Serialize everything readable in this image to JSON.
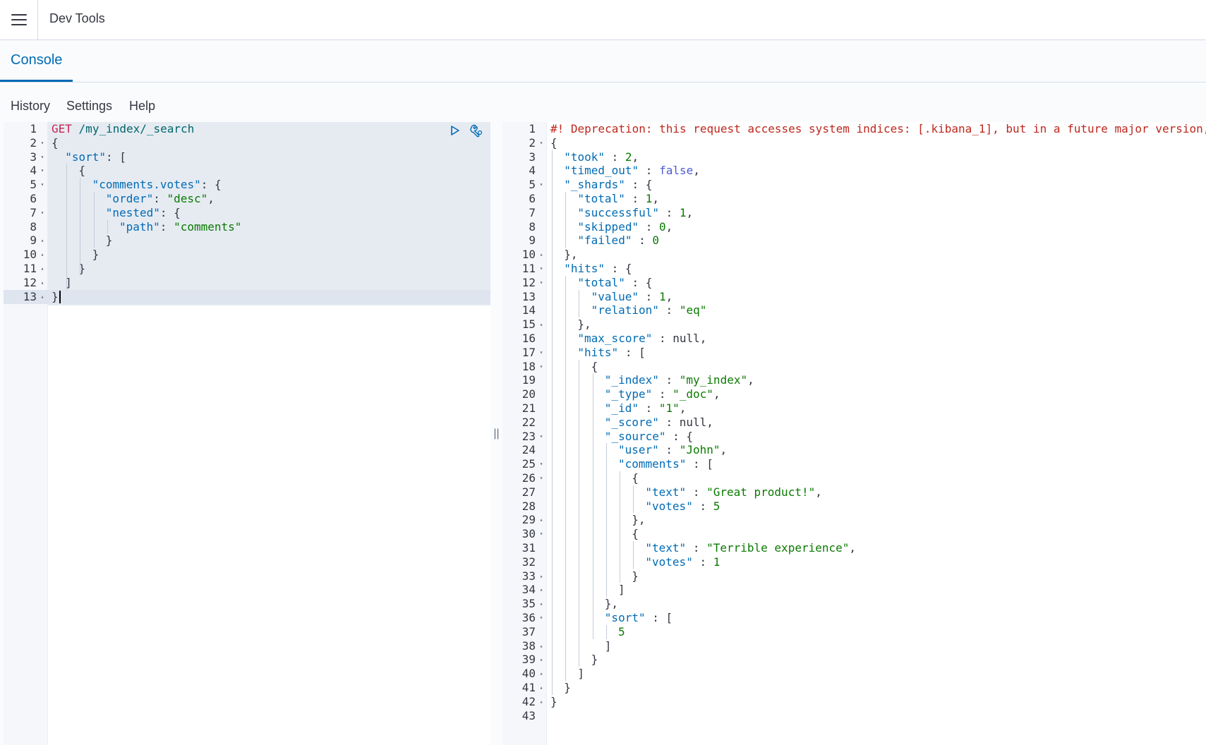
{
  "header": {
    "title": "Dev Tools",
    "menu_icon": "hamburger-icon"
  },
  "tabs": [
    {
      "label": "Console",
      "active": true
    }
  ],
  "actions": {
    "history": "History",
    "settings": "Settings",
    "help": "Help"
  },
  "colors": {
    "accent": "#006bb4",
    "warning": "#bd271e",
    "key": "#006bb4",
    "string": "#0a7a00"
  },
  "request": {
    "method": "GET",
    "url": "/my_index/_search",
    "run_icon": "play-icon",
    "wrench_icon": "wrench-icon",
    "lines": [
      {
        "n": "1",
        "fold": ""
      },
      {
        "n": "2",
        "fold": "down"
      },
      {
        "n": "3",
        "fold": "down"
      },
      {
        "n": "4",
        "fold": "down"
      },
      {
        "n": "5",
        "fold": "down"
      },
      {
        "n": "6",
        "fold": ""
      },
      {
        "n": "7",
        "fold": "down"
      },
      {
        "n": "8",
        "fold": ""
      },
      {
        "n": "9",
        "fold": "up"
      },
      {
        "n": "10",
        "fold": "up"
      },
      {
        "n": "11",
        "fold": "up"
      },
      {
        "n": "12",
        "fold": "up"
      },
      {
        "n": "13",
        "fold": "up"
      }
    ],
    "tokens": {
      "l2": "{",
      "l3_key": "\"sort\"",
      "l3_rest": ": [",
      "l4": "{",
      "l5_key": "\"comments.votes\"",
      "l5_rest": ": {",
      "l6_key": "\"order\"",
      "l6_sep": ": ",
      "l6_val": "\"desc\"",
      "l6_end": ",",
      "l7_key": "\"nested\"",
      "l7_rest": ": {",
      "l8_key": "\"path\"",
      "l8_sep": ": ",
      "l8_val": "\"comments\"",
      "l9": "}",
      "l10": "}",
      "l11": "}",
      "l12": "]",
      "l13": "}"
    }
  },
  "response": {
    "warning": "#! Deprecation: this request accesses system indices: [.kibana_1], but in a future major version,",
    "lines": [
      {
        "n": "1",
        "fold": ""
      },
      {
        "n": "2",
        "fold": "down"
      },
      {
        "n": "3",
        "fold": ""
      },
      {
        "n": "4",
        "fold": ""
      },
      {
        "n": "5",
        "fold": "down"
      },
      {
        "n": "6",
        "fold": ""
      },
      {
        "n": "7",
        "fold": ""
      },
      {
        "n": "8",
        "fold": ""
      },
      {
        "n": "9",
        "fold": ""
      },
      {
        "n": "10",
        "fold": "up"
      },
      {
        "n": "11",
        "fold": "down"
      },
      {
        "n": "12",
        "fold": "down"
      },
      {
        "n": "13",
        "fold": ""
      },
      {
        "n": "14",
        "fold": ""
      },
      {
        "n": "15",
        "fold": "up"
      },
      {
        "n": "16",
        "fold": ""
      },
      {
        "n": "17",
        "fold": "down"
      },
      {
        "n": "18",
        "fold": "down"
      },
      {
        "n": "19",
        "fold": ""
      },
      {
        "n": "20",
        "fold": ""
      },
      {
        "n": "21",
        "fold": ""
      },
      {
        "n": "22",
        "fold": ""
      },
      {
        "n": "23",
        "fold": "down"
      },
      {
        "n": "24",
        "fold": ""
      },
      {
        "n": "25",
        "fold": "down"
      },
      {
        "n": "26",
        "fold": "down"
      },
      {
        "n": "27",
        "fold": ""
      },
      {
        "n": "28",
        "fold": ""
      },
      {
        "n": "29",
        "fold": "up"
      },
      {
        "n": "30",
        "fold": "down"
      },
      {
        "n": "31",
        "fold": ""
      },
      {
        "n": "32",
        "fold": ""
      },
      {
        "n": "33",
        "fold": "up"
      },
      {
        "n": "34",
        "fold": "up"
      },
      {
        "n": "35",
        "fold": "up"
      },
      {
        "n": "36",
        "fold": "down"
      },
      {
        "n": "37",
        "fold": ""
      },
      {
        "n": "38",
        "fold": "up"
      },
      {
        "n": "39",
        "fold": "up"
      },
      {
        "n": "40",
        "fold": "up"
      },
      {
        "n": "41",
        "fold": "up"
      },
      {
        "n": "42",
        "fold": "up"
      },
      {
        "n": "43",
        "fold": ""
      }
    ],
    "code": [
      [],
      [
        [
          "p",
          "{"
        ]
      ],
      [
        [
          "k",
          "\"took\""
        ],
        [
          "p",
          " : "
        ],
        [
          "n",
          "2"
        ],
        [
          "p",
          ","
        ]
      ],
      [
        [
          "k",
          "\"timed_out\""
        ],
        [
          "p",
          " : "
        ],
        [
          "b",
          "false"
        ],
        [
          "p",
          ","
        ]
      ],
      [
        [
          "k",
          "\"_shards\""
        ],
        [
          "p",
          " : {"
        ]
      ],
      [
        [
          "k",
          "\"total\""
        ],
        [
          "p",
          " : "
        ],
        [
          "n",
          "1"
        ],
        [
          "p",
          ","
        ]
      ],
      [
        [
          "k",
          "\"successful\""
        ],
        [
          "p",
          " : "
        ],
        [
          "n",
          "1"
        ],
        [
          "p",
          ","
        ]
      ],
      [
        [
          "k",
          "\"skipped\""
        ],
        [
          "p",
          " : "
        ],
        [
          "n",
          "0"
        ],
        [
          "p",
          ","
        ]
      ],
      [
        [
          "k",
          "\"failed\""
        ],
        [
          "p",
          " : "
        ],
        [
          "n",
          "0"
        ]
      ],
      [
        [
          "p",
          "},"
        ]
      ],
      [
        [
          "k",
          "\"hits\""
        ],
        [
          "p",
          " : {"
        ]
      ],
      [
        [
          "k",
          "\"total\""
        ],
        [
          "p",
          " : {"
        ]
      ],
      [
        [
          "k",
          "\"value\""
        ],
        [
          "p",
          " : "
        ],
        [
          "n",
          "1"
        ],
        [
          "p",
          ","
        ]
      ],
      [
        [
          "k",
          "\"relation\""
        ],
        [
          "p",
          " : "
        ],
        [
          "s",
          "\"eq\""
        ]
      ],
      [
        [
          "p",
          "},"
        ]
      ],
      [
        [
          "k",
          "\"max_score\""
        ],
        [
          "p",
          " : null,"
        ]
      ],
      [
        [
          "k",
          "\"hits\""
        ],
        [
          "p",
          " : ["
        ]
      ],
      [
        [
          "p",
          "{"
        ]
      ],
      [
        [
          "k",
          "\"_index\""
        ],
        [
          "p",
          " : "
        ],
        [
          "s",
          "\"my_index\""
        ],
        [
          "p",
          ","
        ]
      ],
      [
        [
          "k",
          "\"_type\""
        ],
        [
          "p",
          " : "
        ],
        [
          "s",
          "\"_doc\""
        ],
        [
          "p",
          ","
        ]
      ],
      [
        [
          "k",
          "\"_id\""
        ],
        [
          "p",
          " : "
        ],
        [
          "s",
          "\"1\""
        ],
        [
          "p",
          ","
        ]
      ],
      [
        [
          "k",
          "\"_score\""
        ],
        [
          "p",
          " : null,"
        ]
      ],
      [
        [
          "k",
          "\"_source\""
        ],
        [
          "p",
          " : {"
        ]
      ],
      [
        [
          "k",
          "\"user\""
        ],
        [
          "p",
          " : "
        ],
        [
          "s",
          "\"John\""
        ],
        [
          "p",
          ","
        ]
      ],
      [
        [
          "k",
          "\"comments\""
        ],
        [
          "p",
          " : ["
        ]
      ],
      [
        [
          "p",
          "{"
        ]
      ],
      [
        [
          "k",
          "\"text\""
        ],
        [
          "p",
          " : "
        ],
        [
          "s",
          "\"Great product!\""
        ],
        [
          "p",
          ","
        ]
      ],
      [
        [
          "k",
          "\"votes\""
        ],
        [
          "p",
          " : "
        ],
        [
          "n",
          "5"
        ]
      ],
      [
        [
          "p",
          "},"
        ]
      ],
      [
        [
          "p",
          "{"
        ]
      ],
      [
        [
          "k",
          "\"text\""
        ],
        [
          "p",
          " : "
        ],
        [
          "s",
          "\"Terrible experience\""
        ],
        [
          "p",
          ","
        ]
      ],
      [
        [
          "k",
          "\"votes\""
        ],
        [
          "p",
          " : "
        ],
        [
          "n",
          "1"
        ]
      ],
      [
        [
          "p",
          "}"
        ]
      ],
      [
        [
          "p",
          "]"
        ]
      ],
      [
        [
          "p",
          "},"
        ]
      ],
      [
        [
          "k",
          "\"sort\""
        ],
        [
          "p",
          " : ["
        ]
      ],
      [
        [
          "n",
          "5"
        ]
      ],
      [
        [
          "p",
          "]"
        ]
      ],
      [
        [
          "p",
          "}"
        ]
      ],
      [
        [
          "p",
          "]"
        ]
      ],
      [
        [
          "p",
          "}"
        ]
      ],
      [
        [
          "p",
          "}"
        ]
      ],
      []
    ]
  }
}
